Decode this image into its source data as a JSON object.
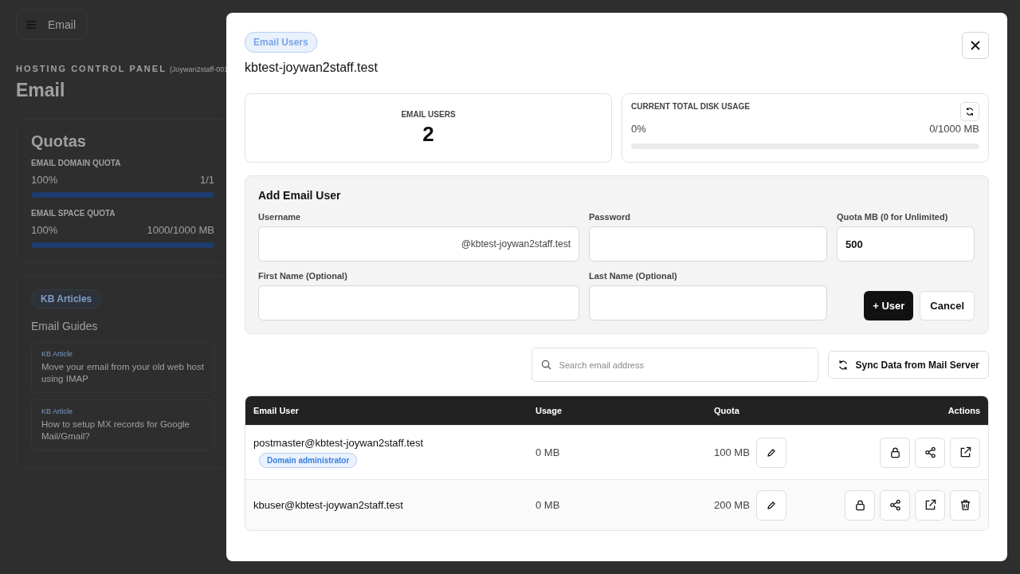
{
  "menu_button": {
    "label": "Email"
  },
  "header": {
    "eyebrow": "HOSTING CONTROL PANEL",
    "account": "(Joywan2staff-001",
    "title": "Email"
  },
  "quotas": {
    "title": "Quotas",
    "items": [
      {
        "label": "EMAIL DOMAIN QUOTA",
        "percent": "100%",
        "reading": "1/1",
        "level": 1
      },
      {
        "label": "EMAIL SPACE QUOTA",
        "percent": "100%",
        "reading": "1000/1000 MB",
        "level": 1
      }
    ]
  },
  "kb": {
    "badge": "KB Articles",
    "title": "Email Guides",
    "articles": [
      {
        "tag": "KB Article",
        "title": "Move your email from your old web host using IMAP"
      },
      {
        "tag": "KB Article",
        "title": "How to setup MX records for Google Mail/Gmail?"
      }
    ]
  },
  "modal": {
    "badge": "Email Users",
    "domain": "kbtest-joywan2staff.test",
    "stats": {
      "users_label": "EMAIL USERS",
      "users_count": "2",
      "disk_label": "CURRENT TOTAL DISK USAGE",
      "disk": {
        "percent": "0%",
        "reading": "0/1000 MB",
        "level": 0
      }
    },
    "form": {
      "title": "Add Email User",
      "username_label": "Username",
      "username_suffix": "@kbtest-joywan2staff.test",
      "password_label": "Password",
      "quota_label": "Quota MB (0 for Unlimited)",
      "quota_value": "500",
      "first_label": "First Name (Optional)",
      "last_label": "Last Name (Optional)",
      "add_button": "+ User",
      "cancel_button": "Cancel"
    },
    "search": {
      "placeholder": "Search email address"
    },
    "sync_button": "Sync Data from Mail Server",
    "table": {
      "columns": [
        "Email User",
        "Usage",
        "Quota",
        "Actions"
      ],
      "rows": [
        {
          "email": "postmaster@kbtest-joywan2staff.test",
          "role": "Domain administrator",
          "usage": "0 MB",
          "quota": "100 MB",
          "actions": [
            {
              "kind": "lock"
            },
            {
              "kind": "share"
            },
            {
              "kind": "external"
            }
          ]
        },
        {
          "email": "kbuser@kbtest-joywan2staff.test",
          "usage": "0 MB",
          "quota": "200 MB",
          "actions": [
            {
              "kind": "lock"
            },
            {
              "kind": "share"
            },
            {
              "kind": "external"
            },
            {
              "kind": "delete"
            }
          ]
        }
      ]
    }
  }
}
